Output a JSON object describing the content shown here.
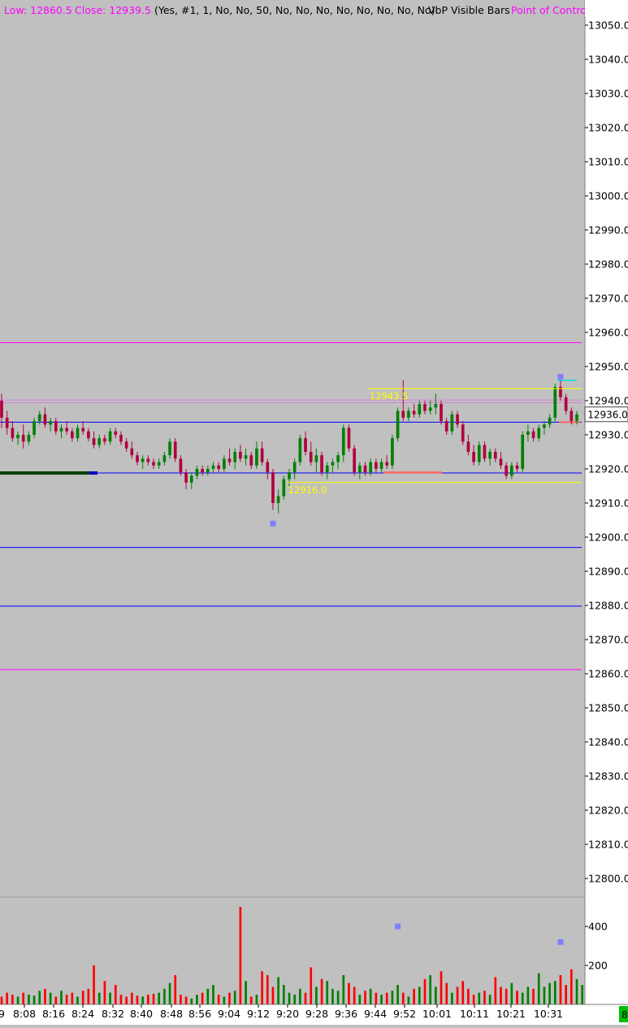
{
  "header": {
    "low_label": "Low: 12860.5",
    "close_label": "Close: 12939.5",
    "params": "(Yes, #1, 1, No, No, 50, No, No, No, No, No, No, No, No)",
    "study_name": "VbP Visible Bars",
    "poc_label": "Point of Contro"
  },
  "colors": {
    "background": "#c0c0c0",
    "axis_bg": "#ffffff",
    "up": "#008000",
    "down": "#b0003c",
    "vol_up": "#008000",
    "vol_down": "#ff0000",
    "magenta": "#ff00ff",
    "blue": "#0000ff",
    "yellow": "#ffff00",
    "marker": "#8080ff",
    "badge": "#00c000"
  },
  "chart_data": [
    {
      "type": "candlestick",
      "title": "",
      "ylim": [
        12795,
        13055
      ],
      "y_ticks": [
        "13050.0",
        "13040.0",
        "13030.0",
        "13020.0",
        "13010.0",
        "13000.0",
        "12990.0",
        "12980.0",
        "12970.0",
        "12960.0",
        "12950.0",
        "12940.0",
        "12930.0",
        "12920.0",
        "12910.0",
        "12900.0",
        "12890.0",
        "12880.0",
        "12870.0",
        "12860.0",
        "12850.0",
        "12840.0",
        "12830.0",
        "12820.0",
        "12810.0",
        "12800.0"
      ],
      "x_ticks": [
        "8:08",
        "8:16",
        "8:24",
        "8:32",
        "8:40",
        "8:48",
        "8:56",
        "9:04",
        "9:12",
        "9:20",
        "9:28",
        "9:36",
        "9:44",
        "9:52",
        "10:01",
        "10:11",
        "10:21",
        "10:31"
      ],
      "x_tick_left_cut": "9",
      "last_price_label": "12936.0",
      "last_price": 12936.0,
      "ohlc": [
        [
          12940,
          12942,
          12932,
          12935
        ],
        [
          12935,
          12937,
          12930,
          12932
        ],
        [
          12932,
          12934,
          12928,
          12929
        ],
        [
          12929,
          12931,
          12927,
          12930
        ],
        [
          12930,
          12933,
          12926,
          12928
        ],
        [
          12928,
          12931,
          12927,
          12930
        ],
        [
          12930,
          12935,
          12929,
          12934
        ],
        [
          12934,
          12937,
          12933,
          12936
        ],
        [
          12936,
          12938,
          12932,
          12933
        ],
        [
          12933,
          12935,
          12931,
          12934
        ],
        [
          12934,
          12935,
          12930,
          12931
        ],
        [
          12931,
          12933,
          12929,
          12932
        ],
        [
          12932,
          12934,
          12930,
          12931
        ],
        [
          12931,
          12932,
          12928,
          12929
        ],
        [
          12929,
          12933,
          12928,
          12932
        ],
        [
          12932,
          12934,
          12930,
          12931
        ],
        [
          12931,
          12932,
          12928,
          12929
        ],
        [
          12929,
          12931,
          12926,
          12927
        ],
        [
          12927,
          12930,
          12926,
          12929
        ],
        [
          12929,
          12930,
          12927,
          12928
        ],
        [
          12928,
          12932,
          12927,
          12931
        ],
        [
          12931,
          12932,
          12929,
          12930
        ],
        [
          12930,
          12931,
          12927,
          12928
        ],
        [
          12928,
          12929,
          12925,
          12926
        ],
        [
          12926,
          12928,
          12923,
          12924
        ],
        [
          12924,
          12925,
          12921,
          12922
        ],
        [
          12922,
          12924,
          12920,
          12923
        ],
        [
          12923,
          12924,
          12921,
          12922
        ],
        [
          12922,
          12923,
          12920,
          12921
        ],
        [
          12921,
          12923,
          12920,
          12922
        ],
        [
          12922,
          12925,
          12921,
          12924
        ],
        [
          12924,
          12929,
          12923,
          12928
        ],
        [
          12928,
          12929,
          12922,
          12923
        ],
        [
          12923,
          12924,
          12918,
          12919
        ],
        [
          12919,
          12920,
          12914,
          12916
        ],
        [
          12916,
          12919,
          12914,
          12918
        ],
        [
          12918,
          12921,
          12917,
          12920
        ],
        [
          12920,
          12921,
          12918,
          12919
        ],
        [
          12919,
          12921,
          12918,
          12920
        ],
        [
          12920,
          12922,
          12919,
          12921
        ],
        [
          12921,
          12922,
          12919,
          12920
        ],
        [
          12920,
          12924,
          12919,
          12923
        ],
        [
          12923,
          12926,
          12921,
          12922
        ],
        [
          12922,
          12926,
          12920,
          12925
        ],
        [
          12925,
          12927,
          12922,
          12923
        ],
        [
          12923,
          12926,
          12921,
          12924
        ],
        [
          12924,
          12925,
          12920,
          12921
        ],
        [
          12921,
          12928,
          12920,
          12926
        ],
        [
          12926,
          12928,
          12921,
          12922
        ],
        [
          12922,
          12923,
          12917,
          12919
        ],
        [
          12919,
          12920,
          12908,
          12910
        ],
        [
          12910,
          12914,
          12907,
          12912
        ],
        [
          12912,
          12918,
          12911,
          12917
        ],
        [
          12917,
          12920,
          12915,
          12919
        ],
        [
          12919,
          12923,
          12917,
          12922
        ],
        [
          12922,
          12930,
          12921,
          12929
        ],
        [
          12929,
          12931,
          12924,
          12925
        ],
        [
          12925,
          12928,
          12921,
          12922
        ],
        [
          12922,
          12926,
          12919,
          12924
        ],
        [
          12924,
          12925,
          12918,
          12919
        ],
        [
          12919,
          12922,
          12917,
          12921
        ],
        [
          12921,
          12923,
          12919,
          12922
        ],
        [
          12922,
          12925,
          12920,
          12924
        ],
        [
          12924,
          12933,
          12922,
          12932
        ],
        [
          12932,
          12933,
          12925,
          12926
        ],
        [
          12926,
          12927,
          12918,
          12919
        ],
        [
          12919,
          12922,
          12917,
          12921
        ],
        [
          12921,
          12922,
          12918,
          12919
        ],
        [
          12919,
          12923,
          12918,
          12922
        ],
        [
          12922,
          12923,
          12919,
          12920
        ],
        [
          12920,
          12923,
          12919,
          12922
        ],
        [
          12922,
          12924,
          12920,
          12921
        ],
        [
          12921,
          12930,
          12920,
          12929
        ],
        [
          12929,
          12938,
          12928,
          12937
        ],
        [
          12937,
          12946,
          12934,
          12935
        ],
        [
          12935,
          12938,
          12934,
          12937
        ],
        [
          12937,
          12939,
          12935,
          12936
        ],
        [
          12936,
          12940,
          12935,
          12939
        ],
        [
          12939,
          12940,
          12936,
          12937
        ],
        [
          12937,
          12940,
          12936,
          12938
        ],
        [
          12938,
          12942,
          12936,
          12939
        ],
        [
          12939,
          12940,
          12933,
          12934
        ],
        [
          12934,
          12935,
          12930,
          12931
        ],
        [
          12931,
          12937,
          12930,
          12936
        ],
        [
          12936,
          12937,
          12932,
          12933
        ],
        [
          12933,
          12934,
          12927,
          12928
        ],
        [
          12928,
          12930,
          12924,
          12925
        ],
        [
          12925,
          12927,
          12921,
          12922
        ],
        [
          12922,
          12928,
          12921,
          12927
        ],
        [
          12927,
          12928,
          12922,
          12923
        ],
        [
          12923,
          12926,
          12921,
          12925
        ],
        [
          12925,
          12926,
          12922,
          12923
        ],
        [
          12923,
          12925,
          12920,
          12921
        ],
        [
          12921,
          12922,
          12917,
          12918
        ],
        [
          12918,
          12922,
          12917,
          12921
        ],
        [
          12921,
          12922,
          12919,
          12920
        ],
        [
          12920,
          12931,
          12919,
          12930
        ],
        [
          12930,
          12933,
          12928,
          12931
        ],
        [
          12931,
          12932,
          12928,
          12929
        ],
        [
          12929,
          12933,
          12928,
          12932
        ],
        [
          12932,
          12934,
          12930,
          12933
        ],
        [
          12933,
          12936,
          12932,
          12935
        ],
        [
          12935,
          12945,
          12934,
          12944
        ],
        [
          12944,
          12946,
          12940,
          12941
        ],
        [
          12941,
          12942,
          12936,
          12937
        ],
        [
          12937,
          12938,
          12933,
          12934
        ],
        [
          12934,
          12937,
          12933,
          12936
        ]
      ],
      "volume": [
        40,
        60,
        50,
        40,
        60,
        50,
        45,
        70,
        80,
        60,
        40,
        70,
        50,
        60,
        40,
        70,
        80,
        200,
        60,
        120,
        60,
        100,
        50,
        40,
        60,
        45,
        40,
        50,
        55,
        60,
        80,
        110,
        150,
        50,
        40,
        30,
        50,
        60,
        80,
        100,
        50,
        40,
        60,
        70,
        500,
        120,
        40,
        50,
        170,
        150,
        90,
        140,
        100,
        60,
        50,
        80,
        60,
        190,
        90,
        130,
        120,
        80,
        70,
        150,
        110,
        90,
        50,
        70,
        80,
        60,
        50,
        60,
        70,
        100,
        60,
        40,
        80,
        90,
        130,
        150,
        90,
        170,
        110,
        60,
        90,
        120,
        80,
        50,
        60,
        70,
        50,
        140,
        90,
        80,
        110,
        70,
        60,
        90,
        80,
        160,
        90,
        110,
        120,
        150,
        100,
        180,
        130,
        100
      ],
      "vol_y_ticks": [
        "400",
        "200"
      ],
      "vol_ylim": [
        0,
        550
      ],
      "levels": [
        {
          "price": 12957.0,
          "color": "magenta"
        },
        {
          "price": 12940.2,
          "color": "pink"
        },
        {
          "price": 12939.4,
          "color": "pink"
        },
        {
          "price": 12933.7,
          "color": "blue"
        },
        {
          "price": 12918.8,
          "color": "blue"
        },
        {
          "price": 12897.0,
          "color": "blue"
        },
        {
          "price": 12879.8,
          "color": "blue"
        },
        {
          "price": 12861.2,
          "color": "magenta"
        }
      ],
      "annotations": [
        {
          "label": "12943.5",
          "price": 12943.5,
          "color": "yellow",
          "from_bar": 72
        },
        {
          "label": "12916.0",
          "price": 12916.0,
          "color": "yellow",
          "from_bar": 57
        }
      ],
      "markers": [
        {
          "bar": 50,
          "price": 12904
        },
        {
          "bar": 103,
          "price": 12947
        },
        {
          "bar": 73,
          "vol": 400,
          "pane": "volume"
        },
        {
          "bar": 103,
          "vol": 320,
          "pane": "volume"
        }
      ],
      "right_badge": "8"
    }
  ]
}
